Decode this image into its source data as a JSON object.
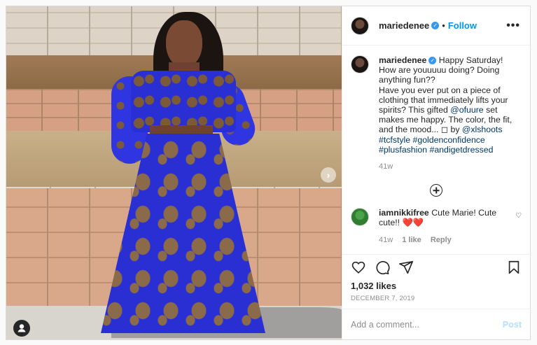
{
  "header": {
    "username": "mariedenee",
    "separator": "•",
    "follow_label": "Follow",
    "more_label": "•••"
  },
  "photo": {
    "next_arrow": "›",
    "icons": {
      "next": "chevron-right-icon",
      "tag": "user-icon"
    }
  },
  "caption": {
    "username": "mariedenee",
    "text_1": "Happy Saturday! How are youuuuu doing? Doing anything fun??",
    "text_2": "Have you ever put on a piece of clothing that immediately lifts your spirits? This gifted",
    "mention_1": "@ofuure",
    "text_3": "set makes me happy. The color, the fit, and the mood... ◻ by",
    "mention_2": "@xlshoots",
    "hashtag_1": "#tcfstyle",
    "hashtag_2": "#goldenconfidence",
    "hashtag_3": "#plusfashion",
    "hashtag_4": "#andigetdressed",
    "time": "41w"
  },
  "comment": {
    "username": "iamnikkifree",
    "text": "Cute Marie! Cute cute!! ❤️❤️",
    "time": "41w",
    "likes": "1 like",
    "reply_label": "Reply"
  },
  "actions": {
    "icons": [
      "heart-icon",
      "comment-icon",
      "share-icon",
      "bookmark-icon"
    ]
  },
  "likes": "1,032 likes",
  "date": "DECEMBER 7, 2019",
  "add_comment": {
    "placeholder": "Add a comment...",
    "post_label": "Post"
  },
  "colors": {
    "accent": "#0095f6",
    "verified": "#3897f0",
    "muted": "#8e8e8e",
    "dress": "#2a2fd4"
  }
}
